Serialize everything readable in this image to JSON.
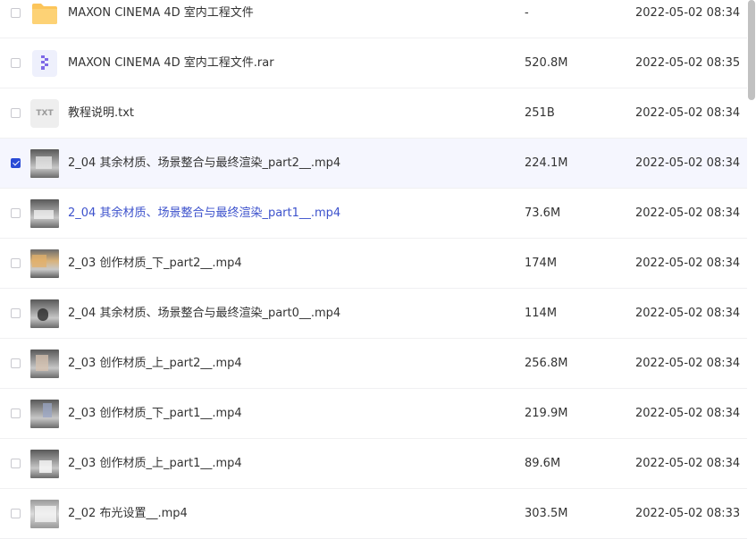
{
  "colors": {
    "accent": "#2a4bd6",
    "link_text": "#3d52cc",
    "selected_row_bg": "#f5f6fe",
    "folder_yellow": "#fcc55a",
    "rar_purple": "#7e68e6"
  },
  "files": [
    {
      "name": "MAXON CINEMA 4D 室内工程文件",
      "size": "-",
      "date": "2022-05-02 08:34",
      "icon": "folder-icon",
      "checked": false
    },
    {
      "name": "MAXON CINEMA 4D 室内工程文件.rar",
      "size": "520.8M",
      "date": "2022-05-02 08:35",
      "icon": "rar-archive-icon",
      "checked": false
    },
    {
      "name": "教程说明.txt",
      "size": "251B",
      "date": "2022-05-02 08:34",
      "icon": "txt-file-icon",
      "icon_label": "TXT",
      "checked": false
    },
    {
      "name": "2_04 其余材质、场景整合与最终渲染_part2__.mp4",
      "size": "224.1M",
      "date": "2022-05-02 08:34",
      "icon": "video-thumbnail",
      "checked": true
    },
    {
      "name": "2_04 其余材质、场景整合与最终渲染_part1__.mp4",
      "size": "73.6M",
      "date": "2022-05-02 08:34",
      "icon": "video-thumbnail",
      "checked": false
    },
    {
      "name": "2_03 创作材质_下_part2__.mp4",
      "size": "174M",
      "date": "2022-05-02 08:34",
      "icon": "video-thumbnail",
      "checked": false
    },
    {
      "name": "2_04 其余材质、场景整合与最终渲染_part0__.mp4",
      "size": "114M",
      "date": "2022-05-02 08:34",
      "icon": "video-thumbnail",
      "checked": false
    },
    {
      "name": "2_03 创作材质_上_part2__.mp4",
      "size": "256.8M",
      "date": "2022-05-02 08:34",
      "icon": "video-thumbnail",
      "checked": false
    },
    {
      "name": "2_03 创作材质_下_part1__.mp4",
      "size": "219.9M",
      "date": "2022-05-02 08:34",
      "icon": "video-thumbnail",
      "checked": false
    },
    {
      "name": "2_03 创作材质_上_part1__.mp4",
      "size": "89.6M",
      "date": "2022-05-02 08:34",
      "icon": "video-thumbnail",
      "checked": false
    },
    {
      "name": "2_02 布光设置__.mp4",
      "size": "303.5M",
      "date": "2022-05-02 08:33",
      "icon": "video-thumbnail",
      "checked": false
    }
  ]
}
